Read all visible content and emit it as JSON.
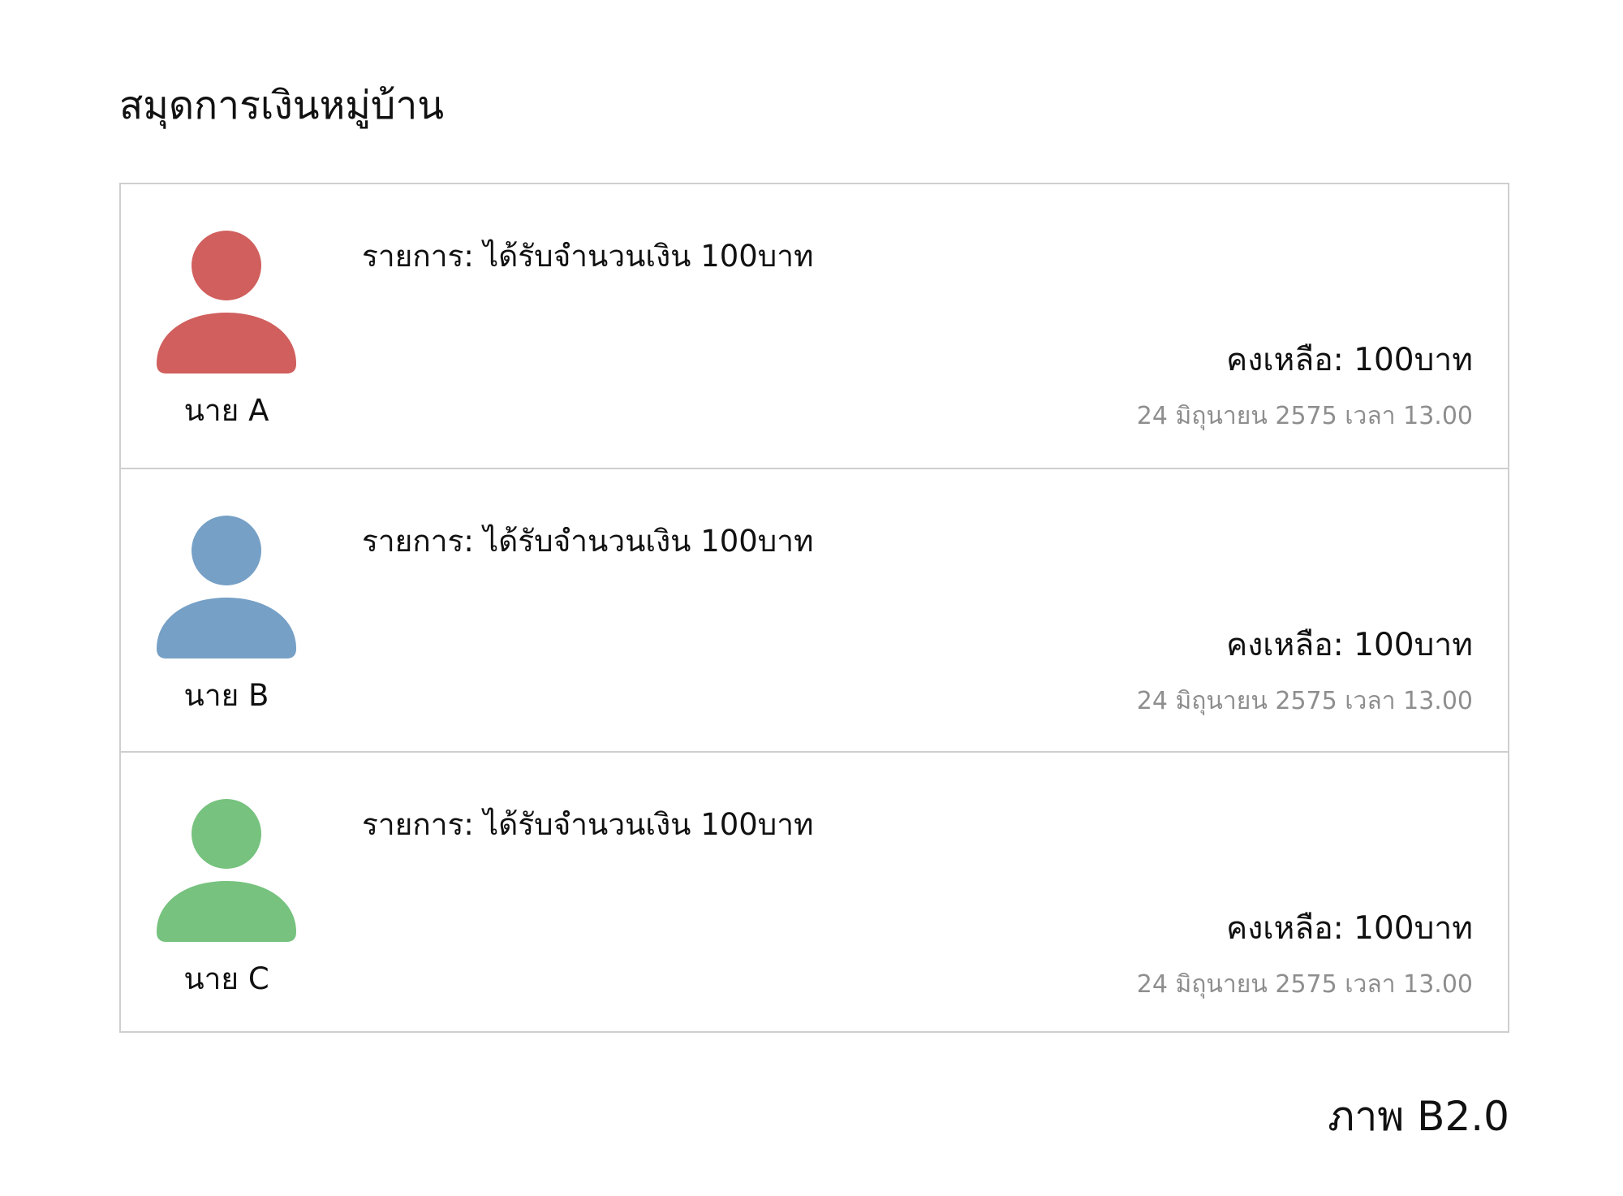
{
  "header": {
    "title": "สมุดการเงินหมู่บ้าน"
  },
  "entries": [
    {
      "name": "นาย A",
      "avatar_icon": "person-icon",
      "avatar_color": "#d05f5d",
      "description": "รายการ: ได้รับจำนวนเงิน 100บาท",
      "balance": "คงเหลือ: 100บาท",
      "timestamp": "24 มิถุนายน 2575 เวลา 13.00"
    },
    {
      "name": "นาย B",
      "avatar_icon": "person-icon",
      "avatar_color": "#76a0c6",
      "description": "รายการ: ได้รับจำนวนเงิน 100บาท",
      "balance": "คงเหลือ: 100บาท",
      "timestamp": "24 มิถุนายน 2575 เวลา 13.00"
    },
    {
      "name": "นาย C",
      "avatar_icon": "person-icon",
      "avatar_color": "#76c27e",
      "description": "รายการ: ได้รับจำนวนเงิน 100บาท",
      "balance": "คงเหลือ: 100บาท",
      "timestamp": "24 มิถุนายน 2575 เวลา 13.00"
    }
  ],
  "caption": "ภาพ B2.0",
  "colors": {
    "border": "#cfcfcf",
    "timestamp_text": "#8e8e8e"
  }
}
